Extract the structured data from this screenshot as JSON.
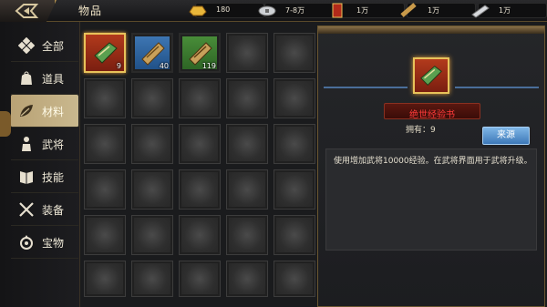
{
  "header": {
    "title": "物品"
  },
  "resources": [
    {
      "name": "gold-ingot-icon",
      "value": "180"
    },
    {
      "name": "silver-coin-icon",
      "value": "7-8万"
    },
    {
      "name": "red-scroll-icon",
      "value": "1万"
    },
    {
      "name": "bamboo-slip-icon",
      "value": "1万"
    },
    {
      "name": "silver-bar-icon",
      "value": "1万"
    }
  ],
  "nav": [
    {
      "label": "全部",
      "icon": "diamond-cluster-icon",
      "active": false
    },
    {
      "label": "道具",
      "icon": "bag-icon",
      "active": false
    },
    {
      "label": "材料",
      "icon": "leaf-icon",
      "active": true
    },
    {
      "label": "武将",
      "icon": "warrior-icon",
      "active": false
    },
    {
      "label": "技能",
      "icon": "book-icon",
      "active": false
    },
    {
      "label": "装备",
      "icon": "crossed-swords-icon",
      "active": false
    },
    {
      "label": "宝物",
      "icon": "treasure-icon",
      "active": false
    }
  ],
  "items": [
    {
      "icon": "green-tome-icon",
      "count": "9",
      "quality": "gold"
    },
    {
      "icon": "blue-scroll-icon",
      "count": "40",
      "quality": "blue"
    },
    {
      "icon": "green-scroll-icon",
      "count": "119",
      "quality": "green"
    }
  ],
  "detail": {
    "name": "绝世经验书",
    "owned": "拥有：9",
    "source_button": "来源",
    "description": "使用增加武将10000经验。在武将界面用于武将升级。"
  },
  "colors": {
    "accent_gold": "#e8c25a",
    "name_red": "#ff3a3a",
    "source_blue": "#3d78b8"
  }
}
